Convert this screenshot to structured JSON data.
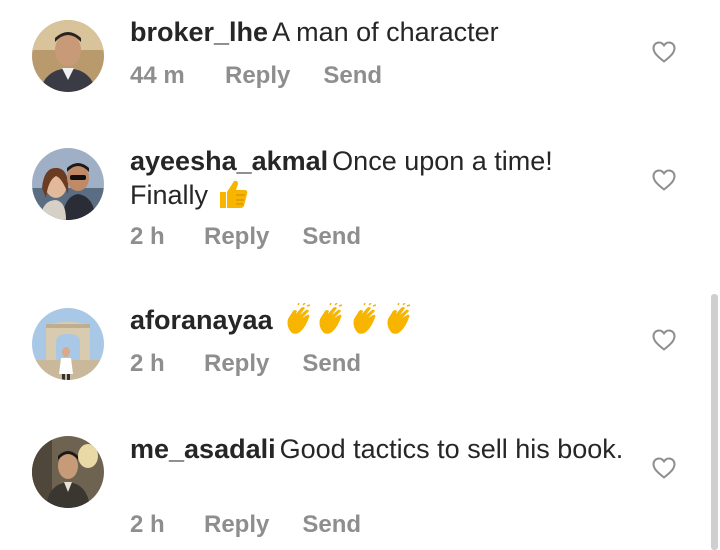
{
  "comments": [
    {
      "username": "broker_lhe",
      "text": "A man of character",
      "time": "44 m",
      "reply_label": "Reply",
      "send_label": "Send"
    },
    {
      "username": "ayeesha_akmal",
      "text": "Once upon a time! Finally",
      "time": "2 h",
      "reply_label": "Reply",
      "send_label": "Send",
      "emoji": "thumbs-up"
    },
    {
      "username": "aforanayaa",
      "text": "",
      "time": "2 h",
      "reply_label": "Reply",
      "send_label": "Send",
      "emoji": "clapping-hands x4"
    },
    {
      "username": "me_asadali",
      "text": "Good tactics to sell his book.",
      "time": "2 h",
      "reply_label": "Reply",
      "send_label": "Send"
    }
  ],
  "icons": {
    "like": "heart-outline-icon",
    "thumbs": "thumbs-up-emoji",
    "clap": "clapping-hands-emoji"
  },
  "colors": {
    "text": "#262626",
    "meta": "#8e8e8e",
    "emoji": "#f7b500"
  }
}
